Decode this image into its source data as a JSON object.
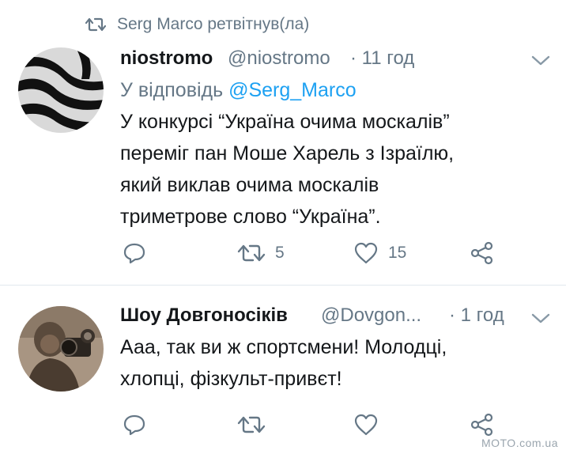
{
  "retweet_banner": {
    "text": "Serg Marco ретвітнув(ла)"
  },
  "tweets": [
    {
      "name": "niostromo",
      "handle": "@niostromo",
      "time": "· 11 год",
      "reply_prefix": "У відповідь",
      "reply_handle": "@Serg_Marco",
      "text_lines": [
        "У конкурсі “Україна очима москалів”",
        "переміг пан Моше Харель з Ізраїлю,",
        "який виклав очима москалів",
        "триметрове слово “Україна”."
      ],
      "retweets": "5",
      "likes": "15"
    },
    {
      "name": "Шоу Довгоносіків",
      "handle": "@Dovgon...",
      "time": "· 1 год",
      "text_lines": [
        "Ааа, так ви ж спортсмени! Молодці,",
        "хлопці, фізкульт-привєт!"
      ]
    }
  ],
  "icons": {
    "retweet_banner": "retweet-icon",
    "menu": "chevron-down-icon",
    "reply": "reply-icon",
    "retweet": "retweet-icon",
    "like": "heart-icon",
    "share": "share-icon"
  },
  "colors": {
    "name": "#14171a",
    "secondary": "#657786",
    "link": "#1da1f2",
    "divider": "#e1e8ed"
  },
  "watermark": "MOTO.com.ua"
}
